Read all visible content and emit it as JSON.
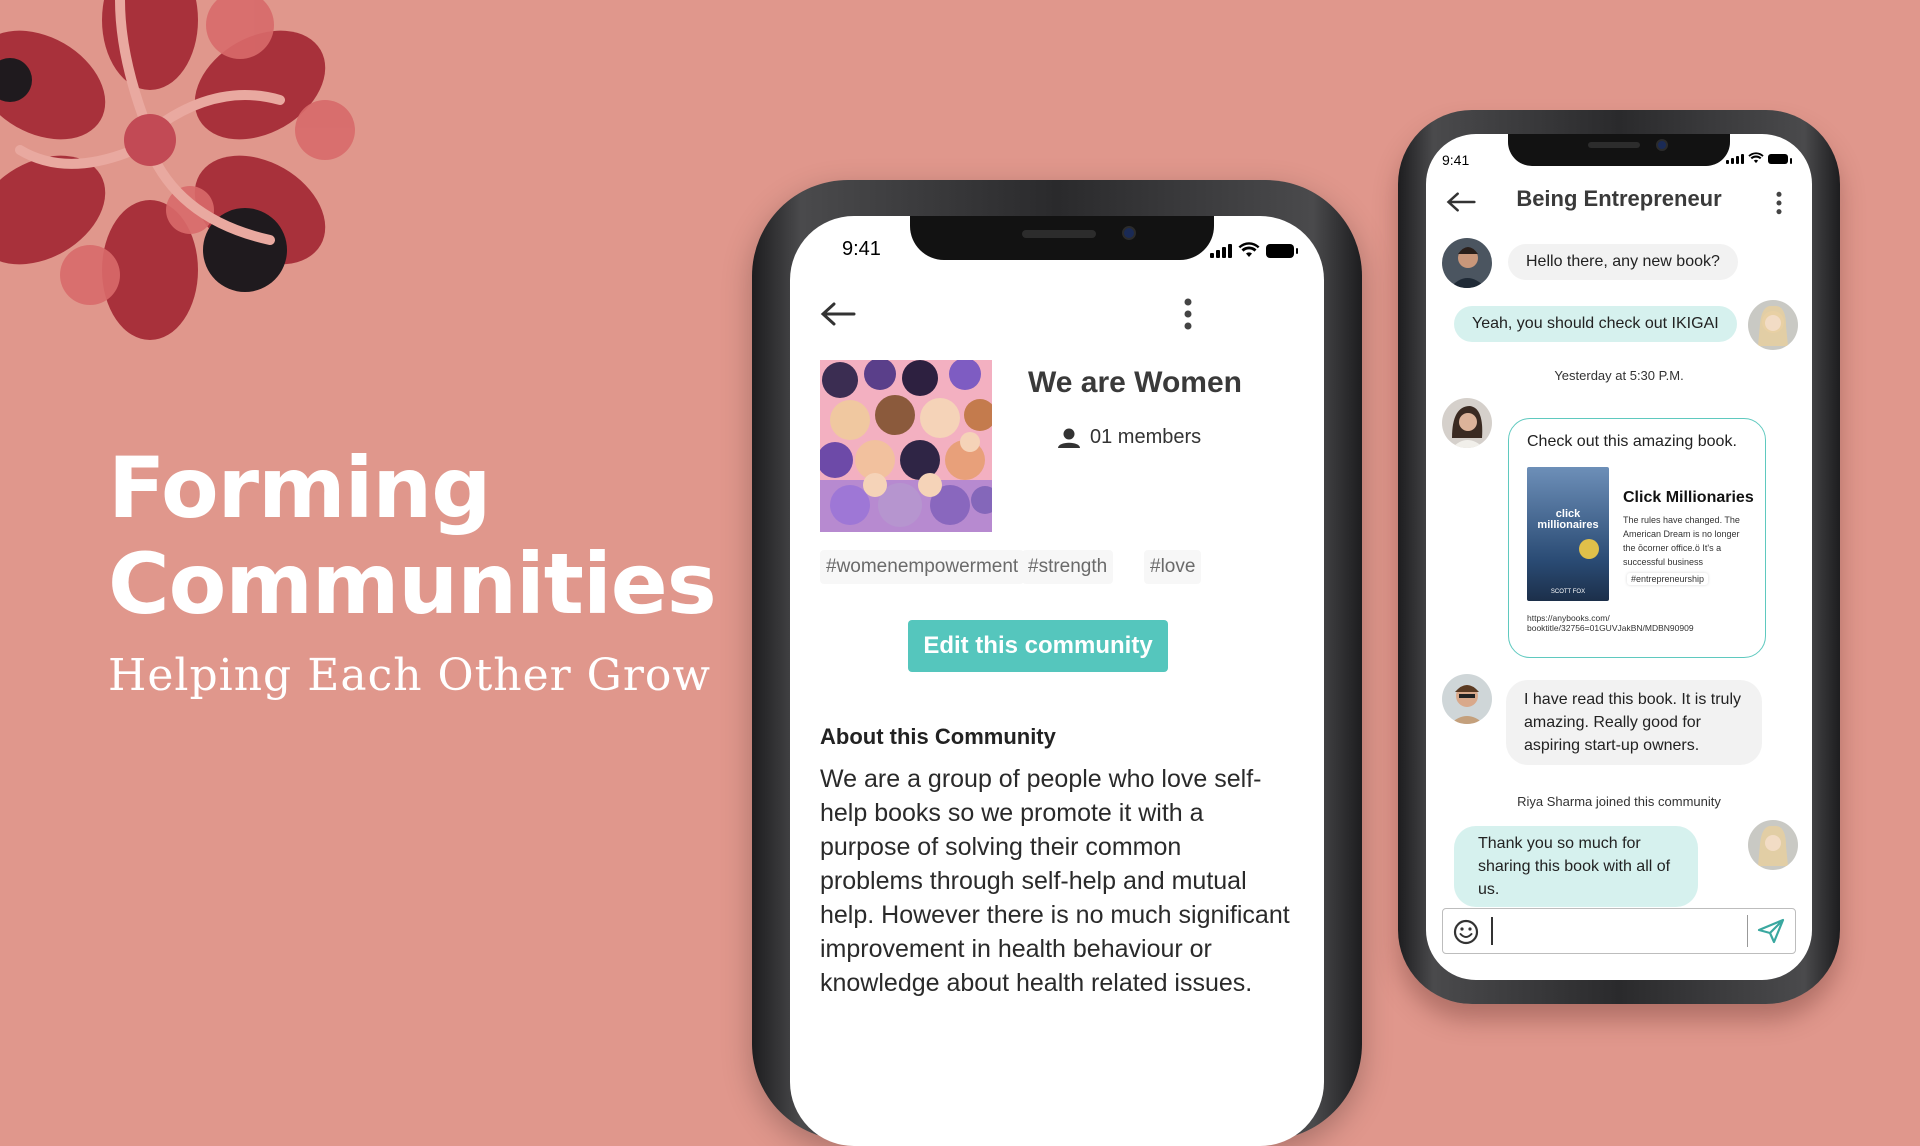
{
  "hero": {
    "title_line1": "Forming",
    "title_line2": "Communities",
    "subtitle": "Helping Each Other Grow"
  },
  "phone1": {
    "status_time": "9:41",
    "community": {
      "name": "We are Women",
      "members": "01 members",
      "tags": [
        "#womenempowerment",
        "#strength",
        "#love"
      ],
      "edit_label": "Edit this community",
      "about_title": "About this Community",
      "about_text": "We are a group of people who love self-help books so we promote it with a purpose of solving their common problems through self-help and mutual help. However there is no much significant improvement in health behaviour or knowledge about health related issues."
    }
  },
  "phone2": {
    "status_time": "9:41",
    "chat_title": "Being Entrepreneur",
    "messages": [
      {
        "text": "Hello there, any new book?"
      },
      {
        "text": "Yeah, you should check out IKIGAI"
      },
      {
        "system": "Yesterday at 5:30 P.M."
      },
      {
        "text": "Check out this amazing book."
      },
      {
        "text": "I have read this book. It is truly amazing. Really good for aspiring start-up owners."
      },
      {
        "system": "Riya Sharma joined this community"
      },
      {
        "text": "Thank you so much for sharing this book with all of us."
      }
    ],
    "book": {
      "title": "Click Millionaries",
      "desc": "The rules have changed. The American Dream is no longer the ōcorner office.ö It's a successful business",
      "tag": "#entrepreneurship",
      "url": "https://anybooks.com/ booktitle/32756=01GUVJakBN/MDBN90909",
      "cover_title": "click millionaires",
      "cover_author": "SCOTT FOX"
    }
  },
  "colors": {
    "background": "#e0978c",
    "accent_teal": "#55c6bd",
    "bubble_me": "#d6f1ee",
    "bubble_other": "#f2f2f2"
  },
  "icons": [
    "back-arrow-icon",
    "more-vert-icon",
    "person-icon",
    "emoji-icon",
    "send-icon",
    "signal-icon",
    "wifi-icon",
    "battery-icon"
  ]
}
